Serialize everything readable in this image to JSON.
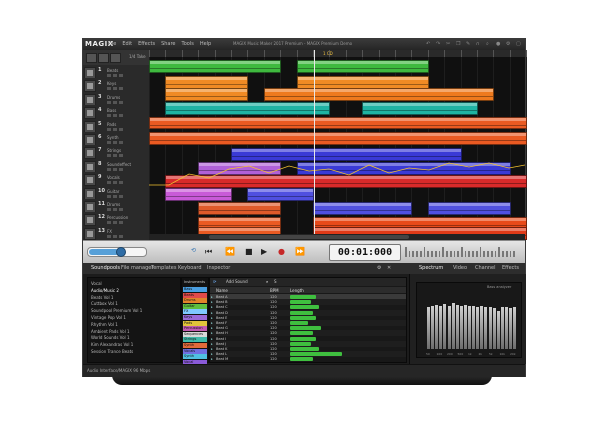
{
  "app": {
    "logo": "MAGIX",
    "window_title": "MAGIX Music Maker 2017 Premium - MAGIX Premium Demo",
    "menu": [
      "File",
      "Edit",
      "Effects",
      "Share",
      "Tools",
      "Help"
    ]
  },
  "arranger": {
    "header_text": "1/4 Take",
    "marker_text": "1 CD",
    "tracks": [
      {
        "num": "1",
        "name": "Beats"
      },
      {
        "num": "2",
        "name": "Keys"
      },
      {
        "num": "3",
        "name": "Drums"
      },
      {
        "num": "4",
        "name": "Bass"
      },
      {
        "num": "5",
        "name": "Pads"
      },
      {
        "num": "6",
        "name": "Synth"
      },
      {
        "num": "7",
        "name": "Strings"
      },
      {
        "num": "8",
        "name": "Soundeffect"
      },
      {
        "num": "9",
        "name": "Vocals"
      },
      {
        "num": "10",
        "name": "Guitar"
      },
      {
        "num": "11",
        "name": "Drums"
      },
      {
        "num": "12",
        "name": "Percussion"
      },
      {
        "num": "13",
        "name": "FX"
      }
    ]
  },
  "transport": {
    "time": "00:01:000",
    "buttons": [
      "rewind-to-start",
      "rewind",
      "stop",
      "play",
      "record",
      "forward"
    ]
  },
  "bottom_tabs": [
    "Soundpools",
    "File manager",
    "Templates",
    "Keyboard",
    "Inspector"
  ],
  "file_list": {
    "items": [
      "Vocal",
      "Audio/Music 2",
      "Beats Vol 1",
      "Cuttbox Vol 1",
      "Soundpool Premium Vol 1",
      "Vintage Pop Vol 1",
      "Rhythm Vol 1",
      "Ambient Pads Vol 1",
      "World Sounds Vol 1",
      "Kim Alexandras Vol 1",
      "Session Trance Beats"
    ],
    "selected": 1
  },
  "categories": {
    "header": "Instruments",
    "items": [
      {
        "name": "Bass",
        "color": "#4a9ee0"
      },
      {
        "name": "Beats",
        "color": "#e04a4a"
      },
      {
        "name": "Drums",
        "color": "#e0842a"
      },
      {
        "name": "Guitar",
        "color": "#5fbf3f"
      },
      {
        "name": "FX",
        "color": "#7fc9ff"
      },
      {
        "name": "Keys",
        "color": "#9a6ad8"
      },
      {
        "name": "Pads",
        "color": "#e0c43a"
      },
      {
        "name": "Percussion",
        "color": "#c05ab0"
      },
      {
        "name": "Sequences",
        "color": "#d8d8d8"
      },
      {
        "name": "Strings",
        "color": "#3fb8a8"
      },
      {
        "name": "Synth",
        "color": "#e06a3a"
      },
      {
        "name": "Vocals",
        "color": "#6f6fe0"
      },
      {
        "name": "Synth",
        "color": "#4fc0e0"
      },
      {
        "name": "Vocal",
        "color": "#8a5ad8"
      }
    ]
  },
  "content": {
    "toolbar": {
      "add": "Add Sound",
      "search": "S"
    },
    "headers": [
      "Name",
      "BPM",
      "Length"
    ],
    "rows": [
      {
        "name": "Beat A",
        "bpm": "120",
        "len": 0.5
      },
      {
        "name": "Beat B",
        "bpm": "120",
        "len": 0.4
      },
      {
        "name": "Beat C",
        "bpm": "120",
        "len": 0.55
      },
      {
        "name": "Beat D",
        "bpm": "120",
        "len": 0.45
      },
      {
        "name": "Beat E",
        "bpm": "120",
        "len": 0.5
      },
      {
        "name": "Beat F",
        "bpm": "120",
        "len": 0.35
      },
      {
        "name": "Beat G",
        "bpm": "120",
        "len": 0.6
      },
      {
        "name": "Beat H",
        "bpm": "120",
        "len": 0.45
      },
      {
        "name": "Beat I",
        "bpm": "120",
        "len": 0.5
      },
      {
        "name": "Beat J",
        "bpm": "120",
        "len": 0.4
      },
      {
        "name": "Beat K",
        "bpm": "120",
        "len": 0.55
      },
      {
        "name": "Beat L",
        "bpm": "120",
        "len": 1.0
      },
      {
        "name": "Beat M",
        "bpm": "120",
        "len": 0.45
      }
    ],
    "selected": 0
  },
  "right_panel": {
    "tabs": [
      "Spectrum",
      "Video",
      "Channel",
      "Effects"
    ],
    "label": "Bass anaiyzer",
    "bars": [
      0.78,
      0.8,
      0.82,
      0.8,
      0.84,
      0.8,
      0.85,
      0.82,
      0.8,
      0.82,
      0.79,
      0.8,
      0.78,
      0.79,
      0.77,
      0.78,
      0.76,
      0.7,
      0.78,
      0.77,
      0.76,
      0.78
    ],
    "xlabels": [
      "50",
      "100",
      "200",
      "500",
      "1k",
      "2k",
      "5k",
      "10k",
      "20k"
    ]
  },
  "status": "Audio Interface/MAGIX 96 Mbps"
}
